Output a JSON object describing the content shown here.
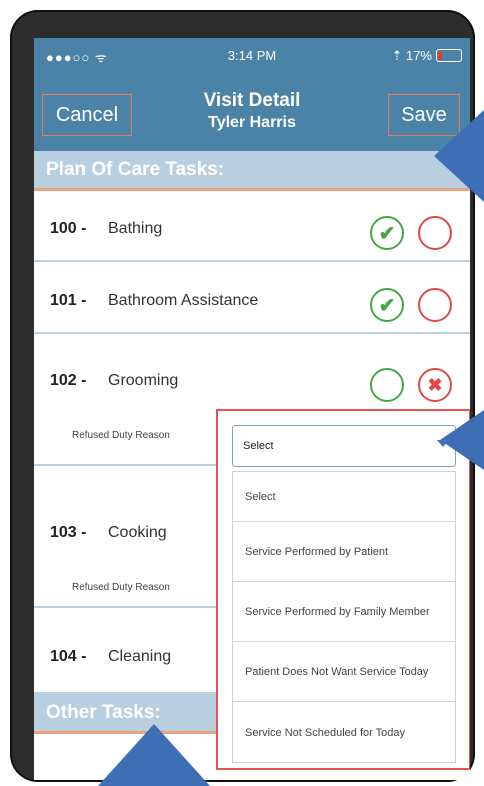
{
  "status_bar": {
    "signal": "●●●○○ ᯤ",
    "time": "3:14 PM",
    "battery": "⇡ 17%"
  },
  "header": {
    "cancel_label": "Cancel",
    "save_label": "Save",
    "title": "Visit Detail",
    "subtitle": "Tyler Harris"
  },
  "sections": {
    "plan_of_care": "Plan Of Care Tasks:",
    "other_tasks": "Other Tasks:"
  },
  "tasks": [
    {
      "number": "100 -",
      "name": "Bathing",
      "state": "completed"
    },
    {
      "number": "101 -",
      "name": "Bathroom Assistance",
      "state": "completed"
    },
    {
      "number": "102 -",
      "name": "Grooming",
      "state": "refused",
      "reason_label": "Refused Duty Reason"
    },
    {
      "number": "103 -",
      "name": "Cooking",
      "reason_label": "Refused Duty Reason"
    },
    {
      "number": "104 -",
      "name": "Cleaning"
    }
  ],
  "dropdown": {
    "selected": "Select",
    "options": [
      "Select",
      "Service Performed by Patient",
      "Service Performed by Family Member",
      "Patient Does Not Want Service Today",
      "Service Not Scheduled for Today"
    ]
  },
  "colors": {
    "header_bg": "#4b83a8",
    "section_bg": "#b9cfdf",
    "check_green": "#47a747",
    "refuse_red": "#e34848",
    "callout_blue": "#3e6fb5"
  },
  "icons": {
    "check": "check-circle-icon",
    "refuse": "x-circle-icon",
    "empty_green": "empty-green-circle-icon",
    "empty_red": "empty-red-circle-icon"
  }
}
